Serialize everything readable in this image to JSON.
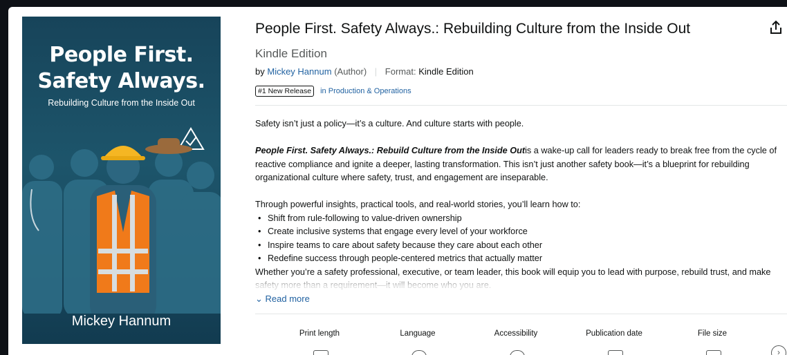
{
  "cover": {
    "title_line1": "People First.",
    "title_line2": "Safety Always.",
    "subtitle": "Rebuilding Culture from the Inside Out",
    "author": "Mickey Hannum"
  },
  "product": {
    "title": "People First. Safety Always.: Rebuilding Culture from the Inside Out",
    "edition": "Kindle Edition",
    "by": "by",
    "author": "Mickey Hannum",
    "author_role": "(Author)",
    "format_label": "Format:",
    "format_value": "Kindle Edition",
    "badge": "#1 New Release",
    "badge_in": "in",
    "category": "Production & Operations"
  },
  "description": {
    "p1": "Safety isn’t just a policy—it’s a culture. And culture starts with people.",
    "p2_bold": "People First. Safety Always.: Rebuild Culture from the Inside Out",
    "p2_rest": "is a wake-up call for leaders ready to break free from the cycle of reactive compliance and ignite a deeper, lasting transformation. This isn’t just another safety book—it’s a blueprint for rebuilding organizational culture where safety, trust, and engagement are inseparable.",
    "p3": "Through powerful insights, practical tools, and real-world stories, you’ll learn how to:",
    "bullets": [
      "Shift from rule-following to value-driven ownership",
      "Create inclusive systems that engage every level of your workforce",
      "Inspire teams to care about safety because they care about each other",
      "Redefine success through people-centered metrics that actually matter"
    ],
    "p4": "Whether you’re a safety professional, executive, or team leader, this book will equip you to lead with purpose, rebuild trust, and make safety more than a requirement—it will become who you are.",
    "read_more": "Read more"
  },
  "attributes": [
    "Print length",
    "Language",
    "Accessibility",
    "Publication date",
    "File size"
  ],
  "icons": {
    "share": "share-icon",
    "chevron": "chevron-down-icon",
    "next": "chevron-right-icon"
  },
  "colors": {
    "link": "#2162a1",
    "cover_bg": "#1d556b",
    "vest": "#f07a1a",
    "hardhat": "#f5b623"
  }
}
